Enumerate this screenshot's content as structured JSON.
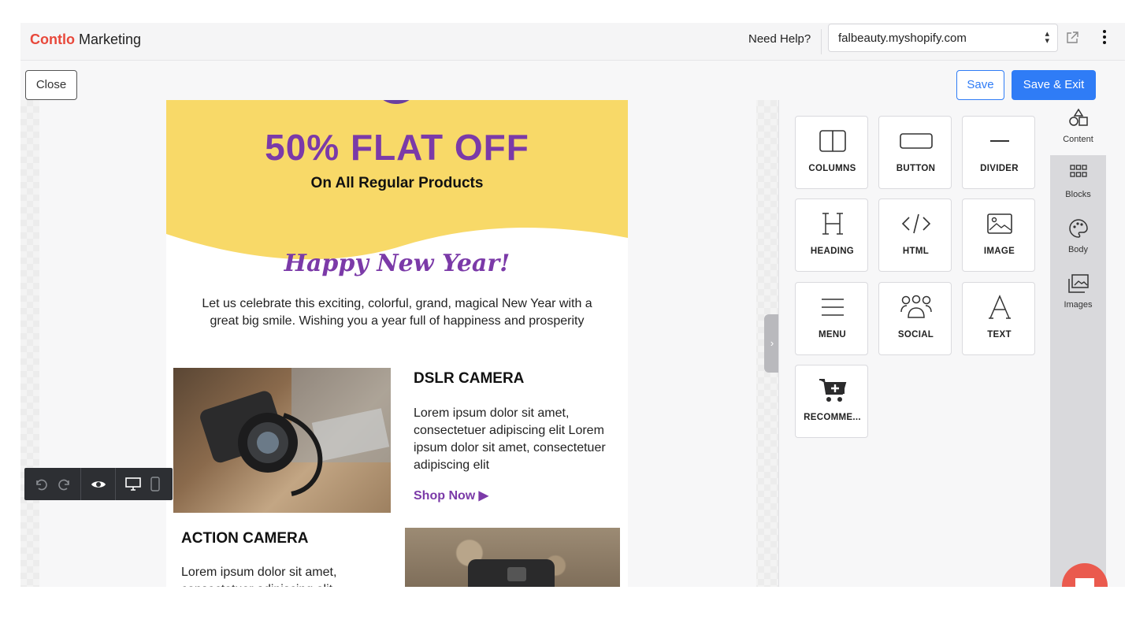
{
  "topbar": {
    "brand_accent": "Contlo",
    "brand_rest": "Marketing",
    "need_help": "Need Help?",
    "store": "falbeauty.myshopify.com"
  },
  "actions": {
    "close": "Close",
    "save": "Save",
    "save_exit": "Save & Exit"
  },
  "email": {
    "hero_title": "50% FLAT OFF",
    "hero_subtitle": "On All Regular Products",
    "greeting": "Happy New Year!",
    "wish": "Let us celebrate this exciting, colorful, grand, magical New Year with a great big smile. Wishing you a year full of happiness and prosperity",
    "product1": {
      "title": "DSLR CAMERA",
      "body": "Lorem ipsum dolor sit amet, consectetuer adipiscing elit Lorem ipsum dolor sit amet, consectetuer adipiscing elit",
      "cta": "Shop Now ▶"
    },
    "product2": {
      "title": "ACTION CAMERA",
      "body": "Lorem ipsum dolor sit amet, consectetuer adipiscing elit"
    }
  },
  "tools": [
    {
      "label": "COLUMNS",
      "icon": "columns-icon"
    },
    {
      "label": "BUTTON",
      "icon": "button-icon"
    },
    {
      "label": "DIVIDER",
      "icon": "divider-icon"
    },
    {
      "label": "HEADING",
      "icon": "heading-icon"
    },
    {
      "label": "HTML",
      "icon": "code-icon"
    },
    {
      "label": "IMAGE",
      "icon": "image-icon"
    },
    {
      "label": "MENU",
      "icon": "menu-icon"
    },
    {
      "label": "SOCIAL",
      "icon": "people-icon"
    },
    {
      "label": "TEXT",
      "icon": "text-icon"
    },
    {
      "label": "RECOMME...",
      "icon": "cart-plus-icon"
    }
  ],
  "side_tabs": [
    {
      "label": "Content",
      "icon": "shapes-icon",
      "active": true
    },
    {
      "label": "Blocks",
      "icon": "grid-icon",
      "active": false
    },
    {
      "label": "Body",
      "icon": "palette-icon",
      "active": false
    },
    {
      "label": "Images",
      "icon": "images-icon",
      "active": false
    }
  ],
  "colors": {
    "brand_accent": "#e8483b",
    "primary_blue": "#2f7cf6",
    "hero_yellow": "#f8d968",
    "purple": "#7b3aa8",
    "chat_bubble": "#ea5a4e"
  }
}
